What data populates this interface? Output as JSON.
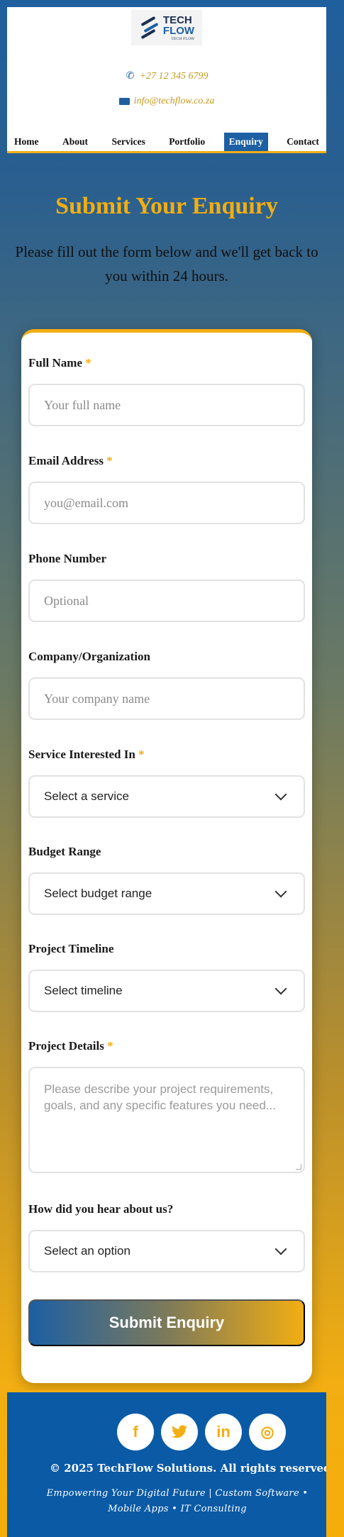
{
  "brand": {
    "logo_line1": "TECH",
    "logo_line2": "FLOW",
    "logo_line3": "TECH FLOW"
  },
  "contact": {
    "phone": "+27 12 345 6799",
    "email": "info@techflow.co.za"
  },
  "nav": {
    "items": [
      {
        "label": "Home"
      },
      {
        "label": "About"
      },
      {
        "label": "Services"
      },
      {
        "label": "Portfolio"
      },
      {
        "label": "Enquiry",
        "active": true
      },
      {
        "label": "Contact"
      }
    ]
  },
  "hero": {
    "title": "Submit Your Enquiry",
    "subtitle": "Please fill out the form below and we'll get back to you within 24 hours."
  },
  "form": {
    "full_name": {
      "label": "Full Name",
      "required": "*",
      "placeholder": "Your full name"
    },
    "email": {
      "label": "Email Address",
      "required": "*",
      "placeholder": "you@email.com"
    },
    "phone": {
      "label": "Phone Number",
      "placeholder": "Optional"
    },
    "company": {
      "label": "Company/Organization",
      "placeholder": "Your company name"
    },
    "service": {
      "label": "Service Interested In",
      "required": "*",
      "selected": "Select a service"
    },
    "budget": {
      "label": "Budget Range",
      "selected": "Select budget range"
    },
    "timeline": {
      "label": "Project Timeline",
      "selected": "Select timeline"
    },
    "details": {
      "label": "Project Details",
      "required": "*",
      "placeholder": "Please describe your project requirements, goals, and any specific features you need..."
    },
    "source": {
      "label": "How did you hear about us?",
      "selected": "Select an option"
    },
    "submit_label": "Submit Enquiry"
  },
  "footer": {
    "socials": [
      {
        "icon": "facebook-icon",
        "glyph": "f"
      },
      {
        "icon": "twitter-icon",
        "glyph": "t"
      },
      {
        "icon": "linkedin-icon",
        "glyph": "in"
      },
      {
        "icon": "instagram-icon",
        "glyph": "◎"
      }
    ],
    "copyright": "© 2025 TechFlow Solutions. All rights reserved.",
    "tagline": "Empowering Your Digital Future | Custom Software • Mobile Apps • IT Consulting"
  },
  "colors": {
    "accent": "#f2ae12",
    "brand_blue": "#1c5fa3",
    "footer_blue": "#0a5aa6"
  }
}
